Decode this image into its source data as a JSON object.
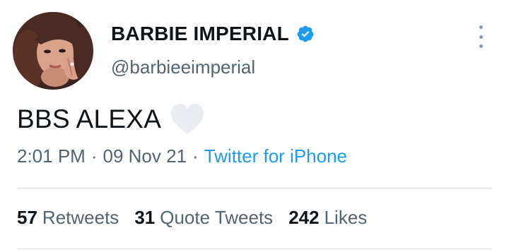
{
  "author": {
    "display_name": "BARBIE IMPERIAL",
    "handle": "@barbieeimperial",
    "verified": true
  },
  "tweet": {
    "text": "BBS ALEXA",
    "emoji": "white-heart"
  },
  "meta": {
    "time": "2:01 PM",
    "separator": "·",
    "date": "09 Nov 21",
    "source": "Twitter for iPhone"
  },
  "stats": {
    "retweets_count": "57",
    "retweets_label": "Retweets",
    "quotes_count": "31",
    "quotes_label": "Quote Tweets",
    "likes_count": "242",
    "likes_label": "Likes"
  },
  "colors": {
    "text": "#0f1419",
    "secondary": "#536471",
    "link": "#1d9bf0",
    "verified": "#1d9bf0"
  }
}
